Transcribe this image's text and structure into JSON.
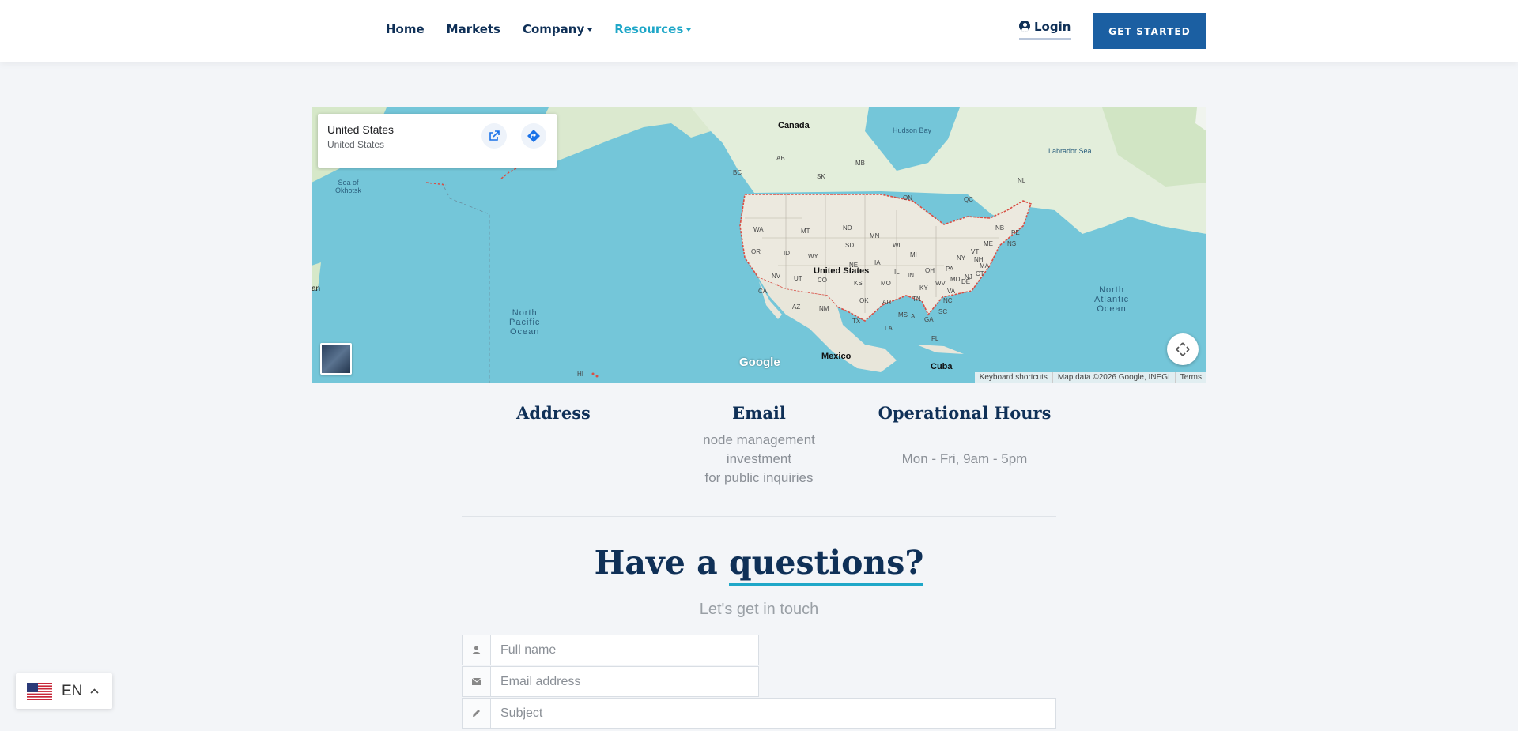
{
  "nav": {
    "home": "Home",
    "markets": "Markets",
    "company": "Company",
    "resources": "Resources",
    "login": "Login",
    "get_started": "GET STARTED"
  },
  "map": {
    "card_title": "United States",
    "card_subtitle": "United States",
    "labels": {
      "canada": "Canada",
      "hudson_bay": "Hudson Bay",
      "labrador_sea": "Labrador Sea",
      "sea_of_okhotsk": "Sea of\nOkhotsk",
      "united_states": "United States",
      "mexico": "Mexico",
      "cuba": "Cuba",
      "north_pacific": "North\nPacific\nOcean",
      "north_atlantic": "North\nAtlantic\nOcean",
      "japan_fragment": "an",
      "hi": "HI"
    },
    "states": [
      "AB",
      "MB",
      "BC",
      "SK",
      "ON",
      "QC",
      "NL",
      "NB",
      "PE",
      "NS",
      "WA",
      "MT",
      "ND",
      "MN",
      "OR",
      "ID",
      "WY",
      "SD",
      "WI",
      "MI",
      "NY",
      "ME",
      "VT",
      "NH",
      "MA",
      "NV",
      "UT",
      "NE",
      "IA",
      "IL",
      "IN",
      "OH",
      "PA",
      "NJ",
      "CT",
      "MD",
      "DE",
      "CA",
      "CO",
      "KS",
      "MO",
      "KY",
      "WV",
      "VA",
      "AZ",
      "NM",
      "OK",
      "AR",
      "TN",
      "NC",
      "SC",
      "TX",
      "LA",
      "MS",
      "AL",
      "GA",
      "FL"
    ],
    "logo": "Google",
    "attribution": [
      "Keyboard shortcuts",
      "Map data ©2026 Google, INEGI",
      "Terms"
    ]
  },
  "contact": {
    "address_title": "Address",
    "email_title": "Email",
    "email_lines": [
      "node management",
      "investment",
      "for public inquiries"
    ],
    "hours_title": "Operational Hours",
    "hours_text": "Mon - Fri, 9am - 5pm"
  },
  "cta_section": {
    "heading_prefix": "Have a",
    "heading_highlight": "questions?",
    "subtitle": "Let's get in touch"
  },
  "form": {
    "full_name_placeholder": "Full name",
    "email_placeholder": "Email address",
    "subject_placeholder": "Subject"
  },
  "language": {
    "code": "EN"
  },
  "colors": {
    "brand_navy": "#0f3057",
    "accent_cyan": "#1fa7c8",
    "button_blue": "#1b5fa2"
  }
}
